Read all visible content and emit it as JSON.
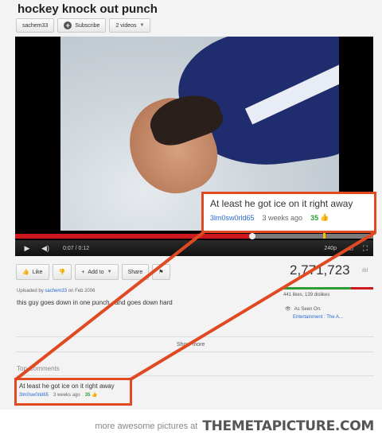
{
  "video": {
    "title": "hockey knock out punch",
    "channel": "sachem33",
    "subscribe_label": "Subscribe",
    "videos_label": "2 videos",
    "time": "0:07 / 0:12",
    "quality": "240p",
    "progress_fraction": 0.66
  },
  "actions": {
    "like_label": "Like",
    "add_to_label": "Add to",
    "share_label": "Share"
  },
  "stats": {
    "views": "2,771,723",
    "likes_text": "441 likes, 139 dislikes",
    "like_fraction": 0.76,
    "seen_on_label": "As Seen On:",
    "seen_on_link": "Entertainment : The A..."
  },
  "upload": {
    "uploaded_by_label": "Uploaded by",
    "uploader": "sachem33",
    "on_label": "on Feb",
    "date": "2006",
    "description": "this guy goes down in one punch.. and goes down hard"
  },
  "show_more_label": "Show more",
  "comments": {
    "heading": "Top Comments",
    "top": {
      "text": "At least he got ice on it right away",
      "user": "3lm0sw0rld65",
      "ago": "3 weeks ago",
      "votes": "35"
    }
  },
  "footer": {
    "text": "more awesome pictures at",
    "logo": "THEMETAPICTURE.COM"
  },
  "colors": {
    "callout": "#e04a22",
    "like_green": "#2d9d33",
    "link_blue": "#2a6bd0",
    "progress_red": "#cc181e"
  }
}
